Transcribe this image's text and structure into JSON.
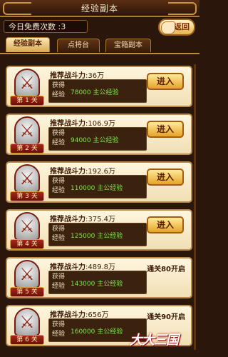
{
  "header": {
    "title": "经验副本",
    "free_count": "今日免费次数 :3",
    "back_label": "返回"
  },
  "tabs": [
    {
      "label": "经验副本",
      "active": true
    },
    {
      "label": "点将台",
      "active": false
    },
    {
      "label": "宝箱副本",
      "active": false
    }
  ],
  "dungeons": [
    {
      "level": "第 1 关",
      "power_label": "推荐战斗力",
      "power": ":36万",
      "reward_label": "获得经验",
      "reward": "78000 主公经验",
      "action": "进入"
    },
    {
      "level": "第 2 关",
      "power_label": "推荐战斗力",
      "power": ":106.9万",
      "reward_label": "获得经验",
      "reward": "94000 主公经验",
      "action": "进入"
    },
    {
      "level": "第 3 关",
      "power_label": "推荐战斗力",
      "power": ":192.6万",
      "reward_label": "获得经验",
      "reward": "110000 主公经验",
      "action": "进入"
    },
    {
      "level": "第 4 关",
      "power_label": "推荐战斗力",
      "power": ":375.4万",
      "reward_label": "获得经验",
      "reward": "125000 主公经验",
      "action": "进入"
    },
    {
      "level": "第 5 关",
      "power_label": "推荐战斗力",
      "power": ":489.8万",
      "reward_label": "获得经验",
      "reward": "143000 主公经验",
      "unlock": "通关80开启"
    },
    {
      "level": "第 6 关",
      "power_label": "推荐战斗力",
      "power": ":656万",
      "reward_label": "获得经验",
      "reward": "160000 主公经验",
      "unlock": "通关90开启"
    }
  ],
  "logo": "大大三国",
  "colors": {
    "reward_text": "#7fe34a",
    "accent": "#e6a427"
  }
}
